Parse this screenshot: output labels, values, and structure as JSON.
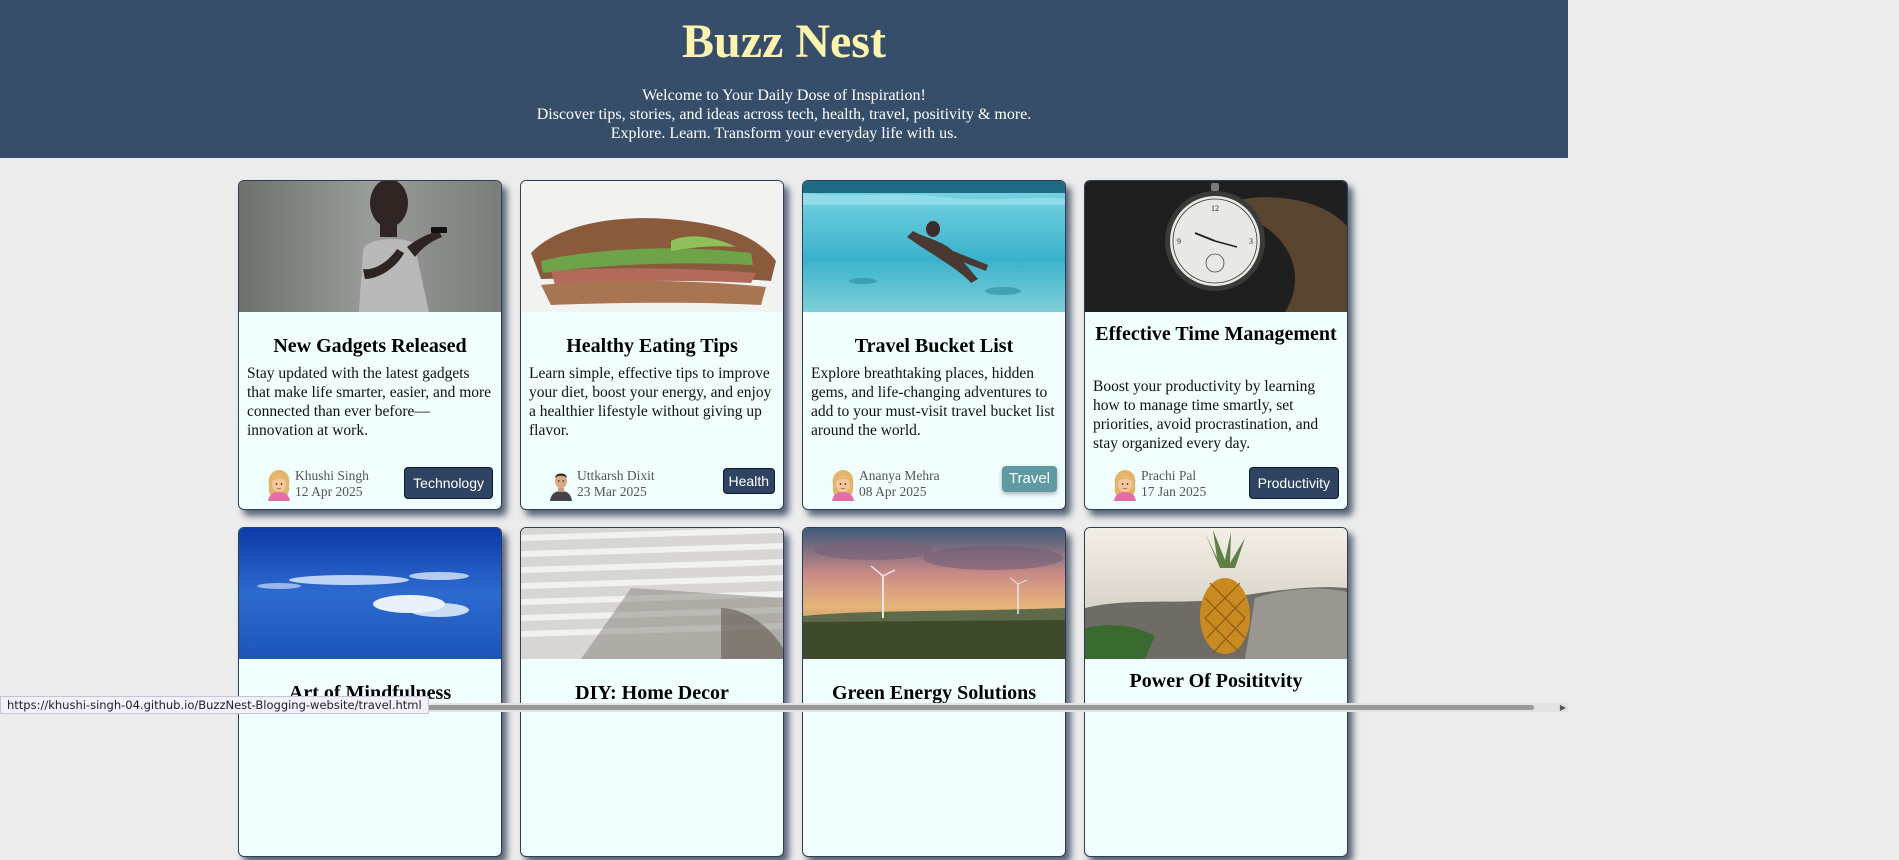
{
  "header": {
    "title": "Buzz Nest",
    "tagline": [
      "Welcome to Your Daily Dose of Inspiration!",
      "Discover tips, stories, and ideas across tech, health, travel, positivity & more.",
      "Explore. Learn. Transform your everyday life with us."
    ]
  },
  "colors": {
    "header_bg": "#374e6a",
    "title": "#fff3b0",
    "card_bg": "#f0fefe",
    "tag_default": "#2f4462",
    "tag_travel": "#5f9aa3"
  },
  "cards": [
    {
      "title": "New Gadgets Released",
      "image": "person-using-phone-photo",
      "description": "Stay updated with the latest gadgets that make life smarter, easier, and more connected than ever before—innovation at work.",
      "author": "Khushi Singh",
      "date": "12 Apr 2025",
      "tag": "Technology",
      "avatar": "woman-emoji-avatar"
    },
    {
      "title": "Healthy Eating Tips",
      "image": "sandwich-photo",
      "description": "Learn simple, effective tips to improve your diet, boost your energy, and enjoy a healthier lifestyle without giving up flavor.",
      "author": "Uttkarsh Dixit",
      "date": "23 Mar 2025",
      "tag": "Health",
      "avatar": "man-avatar"
    },
    {
      "title": "Travel Bucket List",
      "image": "swimmer-underwater-photo",
      "description": "Explore breathtaking places, hidden gems, and life-changing adventures to add to your must-visit travel bucket list around the world.",
      "author": "Ananya Mehra",
      "date": "08 Apr 2025",
      "tag": "Travel",
      "avatar": "woman-emoji-avatar"
    },
    {
      "title": "Effective Time Management",
      "image": "pocket-watch-photo",
      "description": "Boost your productivity by learning how to manage time smartly, set priorities, avoid procrastination, and stay organized every day.",
      "author": "Prachi Pal",
      "date": "17 Jan 2025",
      "tag": "Productivity",
      "avatar": "woman-emoji-avatar"
    },
    {
      "title": "Art of Mindfulness",
      "image": "blue-sky-clouds-photo"
    },
    {
      "title": "DIY: Home Decor",
      "image": "window-blinds-shadow-photo"
    },
    {
      "title": "Green Energy Solutions",
      "image": "wind-turbines-sunset-photo"
    },
    {
      "title": "Power Of Posititvity",
      "image": "pineapple-on-rocks-photo"
    }
  ],
  "status_bar": {
    "url": "https://khushi-singh-04.github.io/BuzzNest-Blogging-website/travel.html"
  }
}
